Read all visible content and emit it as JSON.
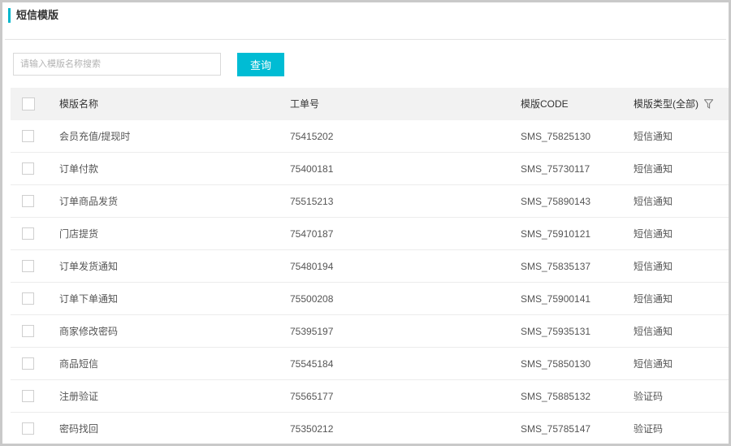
{
  "page": {
    "title": "短信模版"
  },
  "search": {
    "placeholder": "请输入模版名称搜索",
    "value": "",
    "button_label": "查询"
  },
  "table": {
    "headers": {
      "name": "模版名称",
      "order_no": "工单号",
      "code": "模版CODE",
      "type": "模版类型(全部)"
    },
    "rows": [
      {
        "name": "会员充值/提现时",
        "order_no": "75415202",
        "code": "SMS_75825130",
        "type": "短信通知"
      },
      {
        "name": "订单付款",
        "order_no": "75400181",
        "code": "SMS_75730117",
        "type": "短信通知"
      },
      {
        "name": "订单商品发货",
        "order_no": "75515213",
        "code": "SMS_75890143",
        "type": "短信通知"
      },
      {
        "name": "门店提货",
        "order_no": "75470187",
        "code": "SMS_75910121",
        "type": "短信通知"
      },
      {
        "name": "订单发货通知",
        "order_no": "75480194",
        "code": "SMS_75835137",
        "type": "短信通知"
      },
      {
        "name": "订单下单通知",
        "order_no": "75500208",
        "code": "SMS_75900141",
        "type": "短信通知"
      },
      {
        "name": "商家修改密码",
        "order_no": "75395197",
        "code": "SMS_75935131",
        "type": "短信通知"
      },
      {
        "name": "商品短信",
        "order_no": "75545184",
        "code": "SMS_75850130",
        "type": "短信通知"
      },
      {
        "name": "注册验证",
        "order_no": "75565177",
        "code": "SMS_75885132",
        "type": "验证码"
      },
      {
        "name": "密码找回",
        "order_no": "75350212",
        "code": "SMS_75785147",
        "type": "验证码"
      }
    ]
  },
  "icons": {
    "filter": "filter-icon"
  },
  "colors": {
    "accent": "#00bcd4",
    "header_bg": "#f2f2f2",
    "border": "#c9c9c9"
  }
}
